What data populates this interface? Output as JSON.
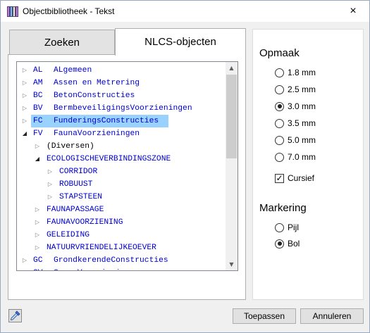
{
  "window": {
    "title": "Objectbibliotheek - Tekst",
    "close_icon": "×"
  },
  "tabs": [
    {
      "label": "Zoeken",
      "active": false
    },
    {
      "label": "NLCS-objecten",
      "active": true
    }
  ],
  "tree": {
    "rows": [
      {
        "code": "AL",
        "label": "ALgemeen",
        "level": 0,
        "expanded": false
      },
      {
        "code": "AM",
        "label": "Assen en Metrering",
        "level": 0,
        "expanded": false
      },
      {
        "code": "BC",
        "label": "BetonConstructies",
        "level": 0,
        "expanded": false
      },
      {
        "code": "BV",
        "label": "BermbeveiligingsVoorzieningen",
        "level": 0,
        "expanded": false
      },
      {
        "code": "FC",
        "label": "FunderingsConstructies",
        "level": 0,
        "expanded": false,
        "selected": true
      },
      {
        "code": "FV",
        "label": "FaunaVoorzieningen",
        "level": 0,
        "expanded": true
      },
      {
        "label": "(Diversen)",
        "level": 1,
        "expanded": false,
        "black": true
      },
      {
        "label": "ECOLOGISCHEVERBINDINGSZONE",
        "level": 1,
        "expanded": true
      },
      {
        "label": "CORRIDOR",
        "level": 2,
        "expanded": false
      },
      {
        "label": "ROBUUST",
        "level": 2,
        "expanded": false
      },
      {
        "label": "STAPSTEEN",
        "level": 2,
        "expanded": false
      },
      {
        "label": "FAUNAPASSAGE",
        "level": 1,
        "expanded": false
      },
      {
        "label": "FAUNAVOORZIENING",
        "level": 1,
        "expanded": false
      },
      {
        "label": "GELEIDING",
        "level": 1,
        "expanded": false
      },
      {
        "label": "NATUURVRIENDELIJKEOEVER",
        "level": 1,
        "expanded": false
      },
      {
        "code": "GC",
        "label": "GrondkerendeConstructies",
        "level": 0,
        "expanded": false
      },
      {
        "code": "GV",
        "label": "GroenVoorzieningen",
        "level": 0,
        "expanded": false
      }
    ]
  },
  "opmaak": {
    "title": "Opmaak",
    "options": [
      "1.8 mm",
      "2.5 mm",
      "3.0 mm",
      "3.5 mm",
      "5.0 mm",
      "7.0 mm"
    ],
    "selected": "3.0 mm",
    "cursief_label": "Cursief",
    "cursief_checked": true
  },
  "markering": {
    "title": "Markering",
    "options": [
      "Pijl",
      "Bol"
    ],
    "selected": "Bol"
  },
  "buttons": {
    "apply": "Toepassen",
    "cancel": "Annuleren"
  },
  "icons": {
    "app": "library-icon",
    "pick": "eyedropper-icon"
  }
}
